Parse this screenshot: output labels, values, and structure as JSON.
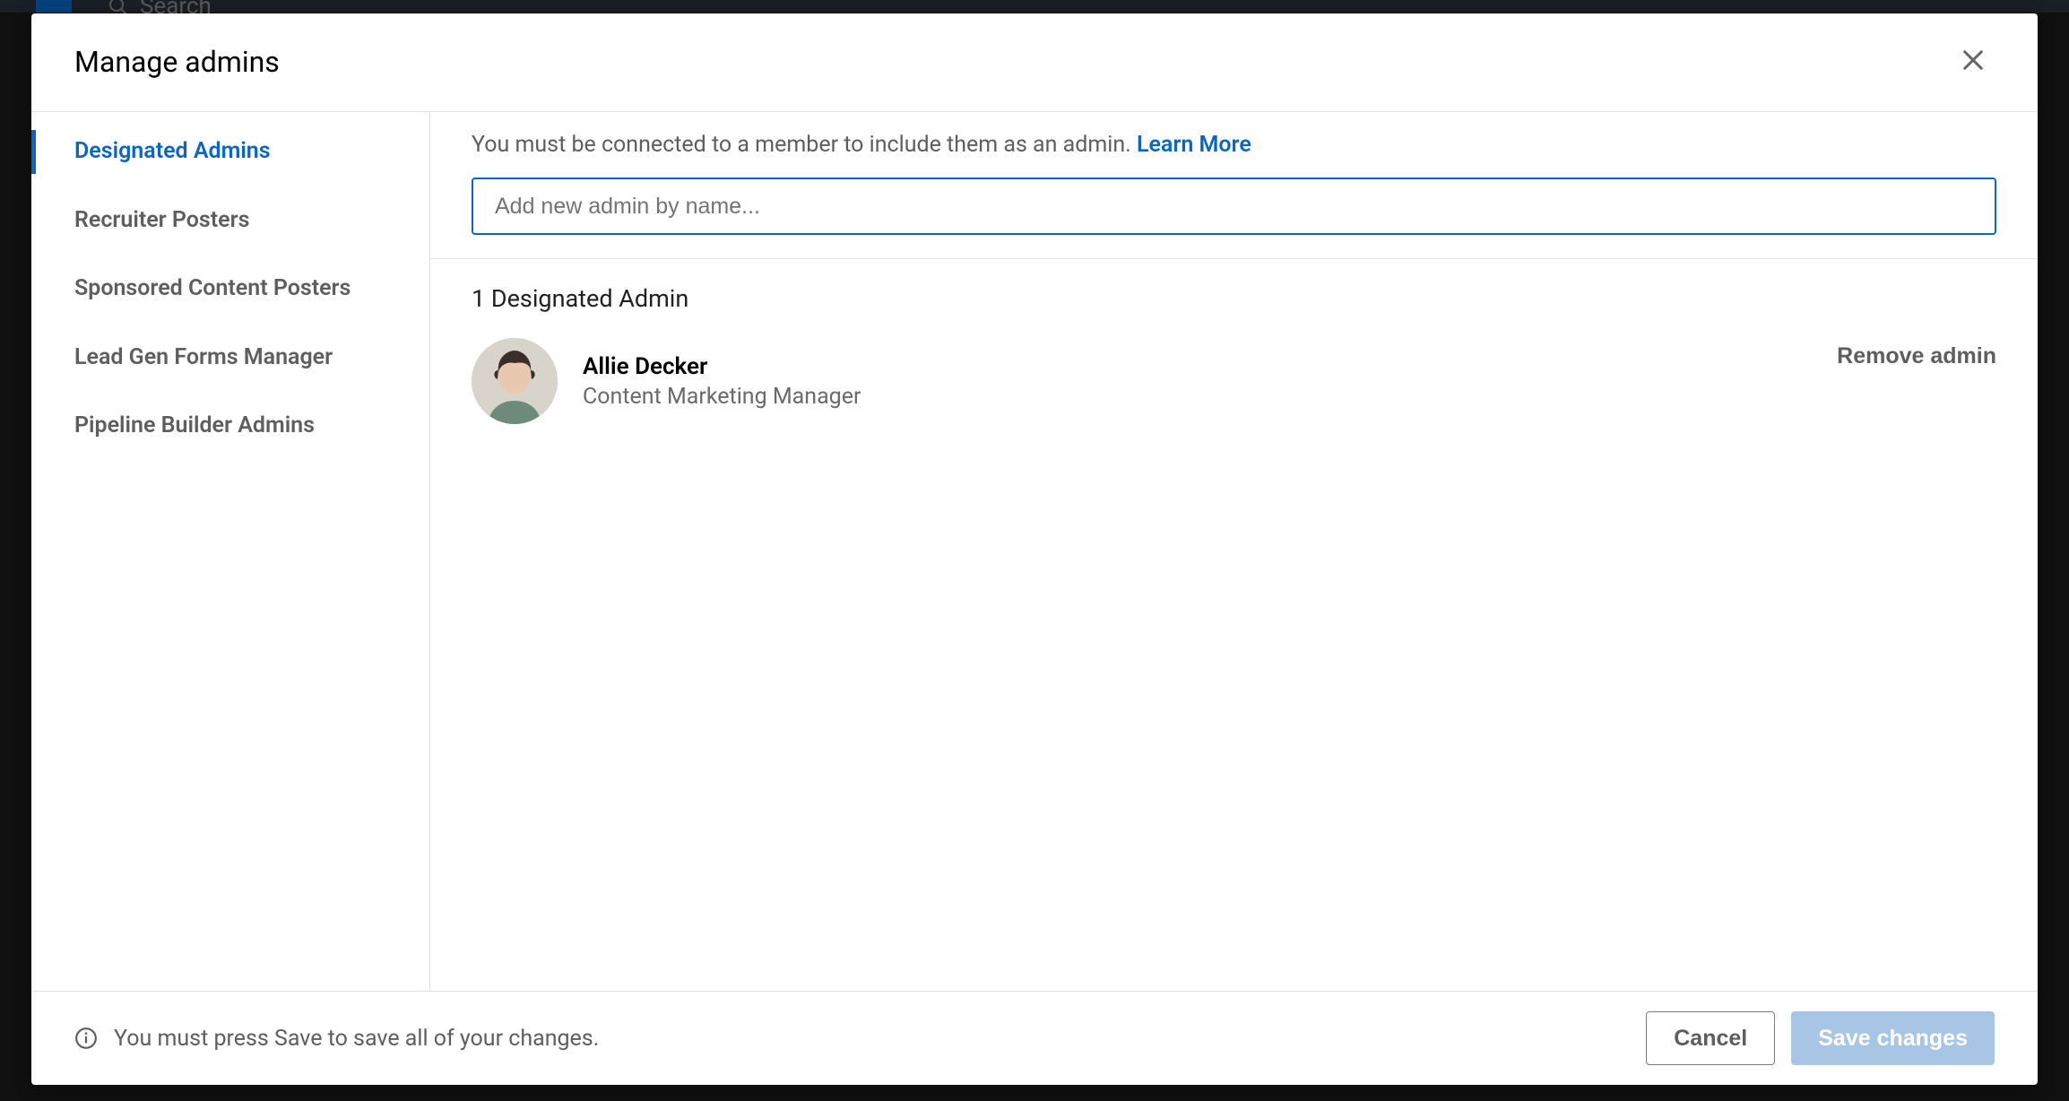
{
  "background": {
    "search_placeholder": "Search"
  },
  "modal": {
    "title": "Manage admins",
    "sidebar": {
      "items": [
        {
          "label": "Designated Admins",
          "active": true
        },
        {
          "label": "Recruiter Posters",
          "active": false
        },
        {
          "label": "Sponsored Content Posters",
          "active": false
        },
        {
          "label": "Lead Gen Forms Manager",
          "active": false
        },
        {
          "label": "Pipeline Builder Admins",
          "active": false
        }
      ]
    },
    "info_text": "You must be connected to a member to include them as an admin. ",
    "learn_more_label": "Learn More",
    "add_admin_placeholder": "Add new admin by name...",
    "admin_count_label": "1 Designated Admin",
    "admins": [
      {
        "name": "Allie Decker",
        "title": "Content Marketing Manager"
      }
    ],
    "remove_label": "Remove admin",
    "footer_note": "You must press Save to save all of your changes.",
    "cancel_label": "Cancel",
    "save_label": "Save changes"
  },
  "colors": {
    "accent": "#0a66c2",
    "save_disabled": "#a9c5e6"
  }
}
